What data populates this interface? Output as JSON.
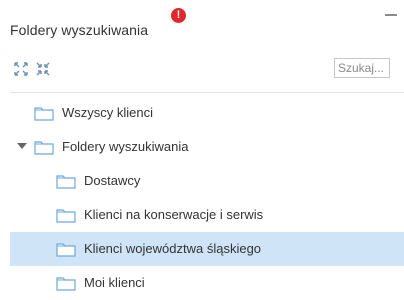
{
  "header": {
    "title": "Foldery wyszukiwania",
    "alert_glyph": "!"
  },
  "toolbar": {
    "search_placeholder": "Szukaj..."
  },
  "tree": {
    "items": [
      {
        "label": "Wszyscy klienci"
      },
      {
        "label": "Foldery wyszukiwania",
        "expanded": true
      },
      {
        "label": "Dostawcy"
      },
      {
        "label": "Klienci na konserwacje i serwis"
      },
      {
        "label": "Klienci województwa śląskiego",
        "selected": true
      },
      {
        "label": "Moi klienci"
      }
    ]
  },
  "colors": {
    "selected_bg": "#cfe4f6",
    "alert": "#e0292d",
    "folder_stroke": "#6fa8dc"
  }
}
